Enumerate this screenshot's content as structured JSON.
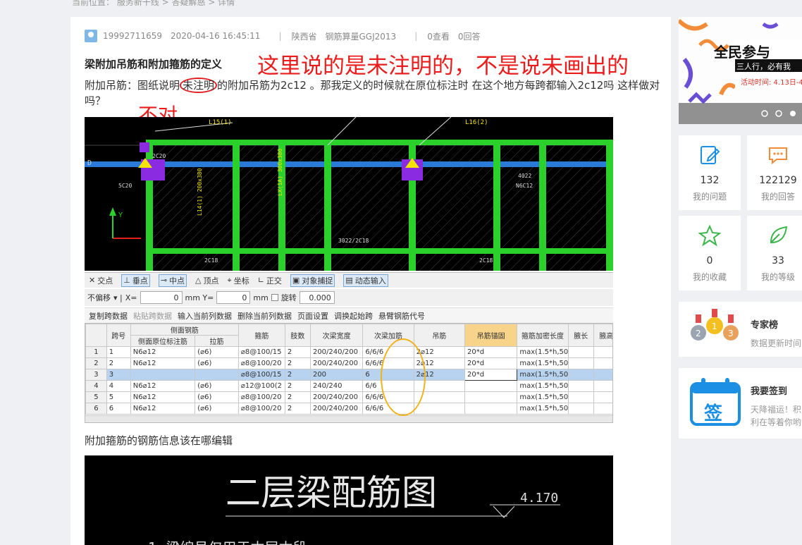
{
  "breadcrumb": "当前位置： 服务新干线 > 答疑解惑 > 详情",
  "meta": {
    "user": "19992711659",
    "datetime": "2020-04-16 16:45:11",
    "region": "陕西省",
    "product": "钢筋算量GGJ2013",
    "views": "0查看",
    "answers": "0回答"
  },
  "question": {
    "title": "梁附加吊筋和附加箍筋的定义",
    "body_pre": "附加吊筋：图纸说明",
    "body_circled": "未注明",
    "body_post": "的附加吊筋为2c12 。那我定义的时候就在原位标注时 在这个地方每跨都输入2c12吗 这样做对吗？",
    "annotation_1": "这里说的是未注明的，不是说未画出的",
    "annotation_2": "不对",
    "question_2": "附加箍筋的钢筋信息该在哪编辑"
  },
  "cad_labels": {
    "l15": "L15(1)",
    "l16": "L16(2)",
    "axis_d": "D",
    "r1": "2C20",
    "r2": "3022/2C18",
    "r3": "4022",
    "r4": "N6C12",
    "r5": "5C20",
    "r6": "2C18",
    "r7": "2C18",
    "axis_y": "Y"
  },
  "toolbar1": [
    "交点",
    "垂点",
    "中点",
    "顶点",
    "坐标",
    "正交",
    "对象捕捉",
    "动态输入"
  ],
  "toolbar2": {
    "offset": "不偏移",
    "x_label": "X=",
    "x_val": "0",
    "y_label": "mm Y=",
    "y_val": "0",
    "unit": "mm",
    "rotate": "旋转",
    "rotate_val": "0.000"
  },
  "toolbar3": [
    "复制跨数据",
    "粘贴跨数据",
    "输入当前列数据",
    "删除当前列数据",
    "页面设置",
    "调换起始跨",
    "悬臂钢筋代号"
  ],
  "grid": {
    "group_header": "侧面钢筋",
    "headers": [
      "",
      "跨号",
      "侧面原位标注筋",
      "拉筋",
      "箍筋",
      "肢数",
      "次梁宽度",
      "次梁加筋",
      "吊筋",
      "吊筋锚固",
      "箍筋加密长度",
      "腋长",
      "腋高",
      "加腋"
    ],
    "rows": [
      [
        "1",
        "1",
        "N6⌀12",
        "(⌀6)",
        "⌀8@100/15",
        "2",
        "200/240/200",
        "6/6/6",
        "2⌀12",
        "20*d",
        "max(1.5*h,50",
        "",
        "",
        ""
      ],
      [
        "2",
        "2",
        "N6⌀12",
        "(⌀6)",
        "⌀8@100/20",
        "2",
        "200/240/200",
        "6/6/6",
        "2⌀12",
        "20*d",
        "max(1.5*h,50",
        "",
        "",
        ""
      ],
      [
        "3",
        "3",
        "",
        "",
        "⌀8@100/15",
        "2",
        "200",
        "6",
        "2⌀12",
        "20*d",
        "max(1.5*h,50",
        "",
        "",
        ""
      ],
      [
        "4",
        "4",
        "N6⌀12",
        "(⌀6)",
        "⌀12@100(2",
        "2",
        "240/240",
        "6/6",
        "",
        "",
        "max(1.5*h,50",
        "",
        "",
        ""
      ],
      [
        "5",
        "5",
        "N6⌀12",
        "(⌀6)",
        "⌀8@100/20",
        "2",
        "200/240/200",
        "6/6/6",
        "",
        "",
        "max(1.5*h,50",
        "",
        "",
        ""
      ],
      [
        "6",
        "6",
        "N6⌀12",
        "(⌀6)",
        "⌀8@100/20",
        "2",
        "200/240/200",
        "6/6/6",
        "",
        "",
        "max(1.5*h,50",
        "",
        "",
        ""
      ]
    ]
  },
  "cad2": {
    "title": "二层梁配筋图",
    "elevation": "4.170",
    "note": "1. 梁编号仅用于本层本段"
  },
  "sidebar": {
    "banner_title": "全民参与",
    "banner_sub": "三人行，必有我",
    "banner_date": "活动时间: 4.13日-4",
    "stats": [
      {
        "num": "132",
        "label": "我的问题"
      },
      {
        "num": "122129",
        "label": "我的回答"
      },
      {
        "num": "0",
        "label": "我的收藏"
      },
      {
        "num": "33",
        "label": "我的等级"
      }
    ],
    "rank_title": "专家榜",
    "rank_sub": "数据更新时间",
    "signin_title": "我要签到",
    "signin_icon_text": "签",
    "signin_sub1": "天降福运！积",
    "signin_sub2": "利在等着你哟"
  },
  "colors": {
    "accent": "#1a8fe3",
    "red": "#ea1c1c",
    "green": "#32c832"
  }
}
